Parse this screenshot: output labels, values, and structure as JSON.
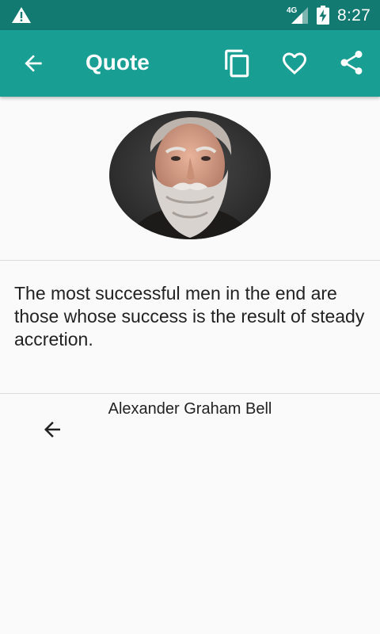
{
  "status_bar": {
    "warning_icon": "warning-icon",
    "network_label": "4G",
    "signal_icon": "signal-icon",
    "battery_icon": "battery-charging-icon",
    "time": "8:27"
  },
  "app_bar": {
    "back_icon": "arrow-back-icon",
    "title": "Quote",
    "copy_icon": "copy-icon",
    "favorite_icon": "heart-outline-icon",
    "share_icon": "share-icon",
    "background_color": "#199e94",
    "status_bar_color": "#137a72"
  },
  "quote": {
    "author_portrait": "author-portrait",
    "text": "The most successful men in the end are those whose success is the result of steady accretion.",
    "author": "Alexander Graham Bell"
  },
  "bottom": {
    "back_icon": "arrow-back-icon"
  }
}
